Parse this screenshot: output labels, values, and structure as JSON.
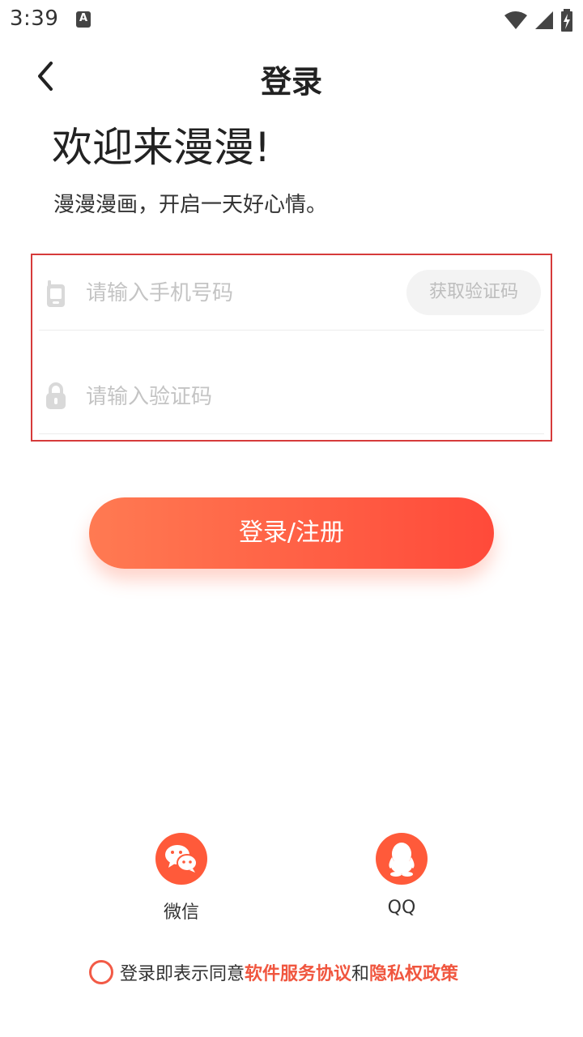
{
  "status_bar": {
    "time": "3:39",
    "a_badge": "A",
    "icons": [
      "wifi-icon",
      "signal-icon",
      "battery-charging-icon"
    ]
  },
  "nav": {
    "title": "登录",
    "back_icon": "chevron-left-icon"
  },
  "welcome": {
    "title": "欢迎来漫漫!",
    "subtitle": "漫漫漫画，开启一天好心情。"
  },
  "form": {
    "phone": {
      "icon": "phone-icon",
      "placeholder": "请输入手机号码",
      "value": ""
    },
    "get_code_label": "获取验证码",
    "code": {
      "icon": "lock-icon",
      "placeholder": "请输入验证码",
      "value": ""
    }
  },
  "login_button_label": "登录/注册",
  "social": {
    "wechat": {
      "label": "微信",
      "icon": "wechat-icon"
    },
    "qq": {
      "label": "QQ",
      "icon": "qq-icon"
    }
  },
  "agreement": {
    "prefix": "登录即表示同意",
    "link_service": "软件服务协议",
    "joiner": "和",
    "link_privacy": "隐私权政策"
  },
  "colors": {
    "accent": "#ff5a3a",
    "link": "#f0563f",
    "highlight_border": "#d63b3b",
    "placeholder": "#c4c4c4"
  }
}
